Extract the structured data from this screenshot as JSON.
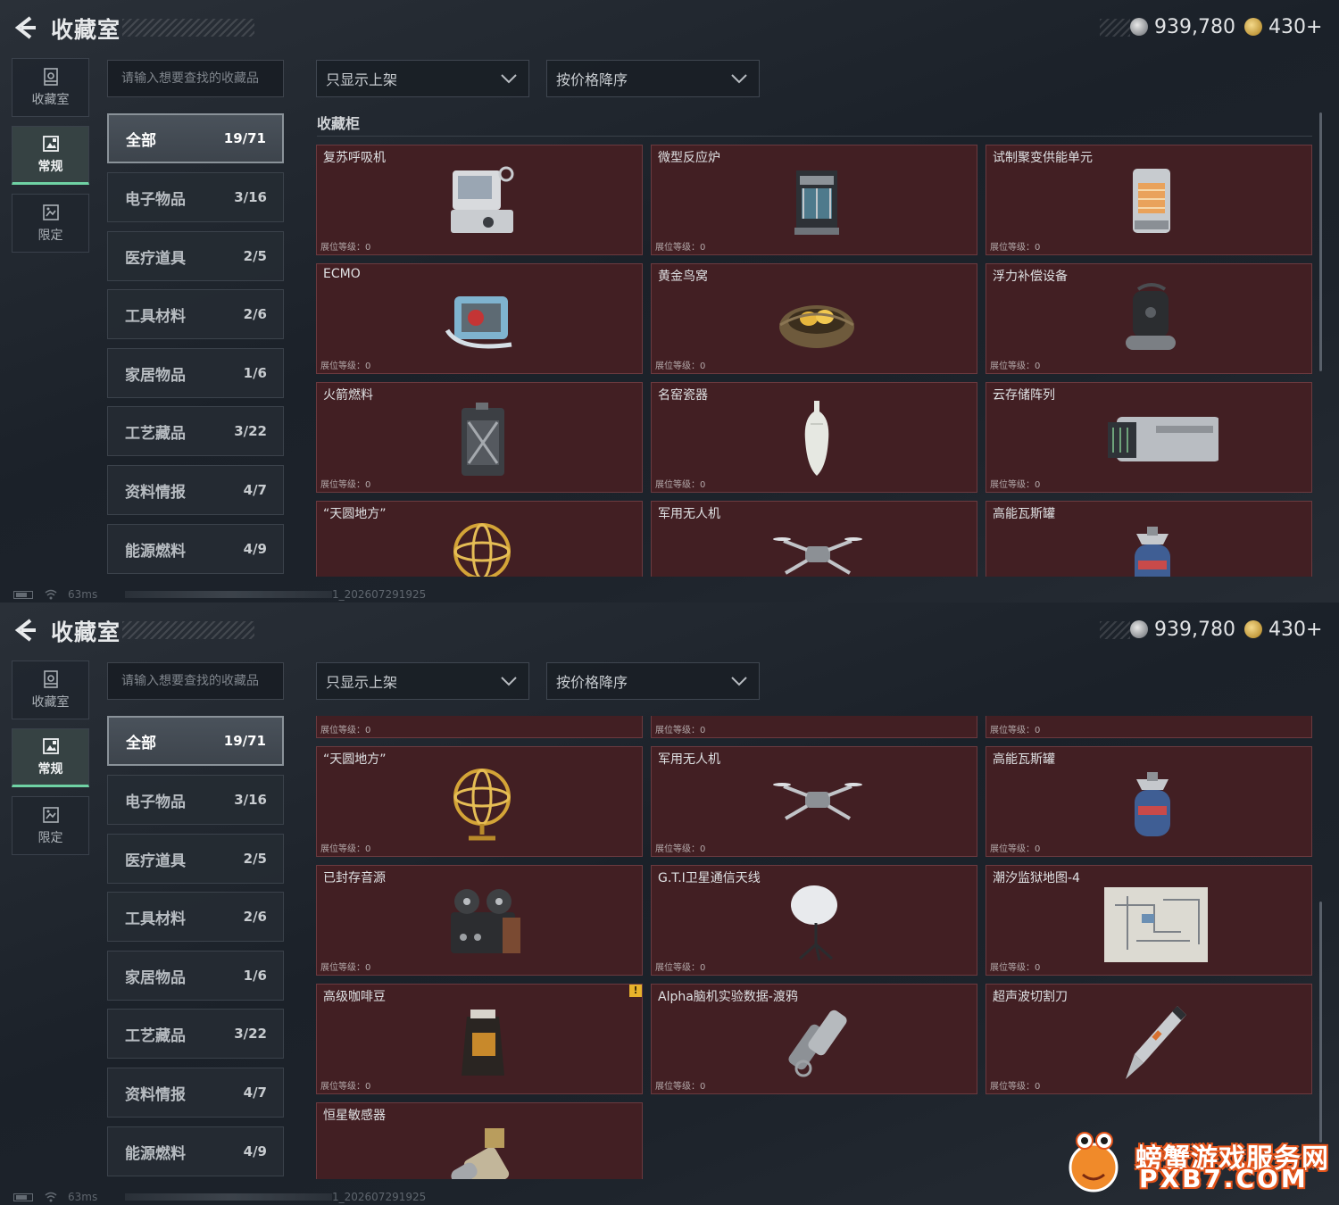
{
  "header": {
    "title": "收藏室",
    "currency_silver": "939,780",
    "currency_gold": "430+"
  },
  "nav": [
    {
      "label": "收藏室",
      "icon": "collection-room-icon"
    },
    {
      "label": "常规",
      "icon": "gallery-icon",
      "active": true
    },
    {
      "label": "限定",
      "icon": "limited-image-icon"
    }
  ],
  "search": {
    "placeholder": "请输入想要查找的收藏品"
  },
  "categories": [
    {
      "name": "全部",
      "count": "19/71"
    },
    {
      "name": "电子物品",
      "count": "3/16"
    },
    {
      "name": "医疗道具",
      "count": "2/5"
    },
    {
      "name": "工具材料",
      "count": "2/6"
    },
    {
      "name": "家居物品",
      "count": "1/6"
    },
    {
      "name": "工艺藏品",
      "count": "3/22"
    },
    {
      "name": "资料情报",
      "count": "4/7"
    },
    {
      "name": "能源燃料",
      "count": "4/9"
    }
  ],
  "filters": {
    "show_filter": "只显示上架",
    "sort": "按价格降序"
  },
  "section_title": "收藏柜",
  "level_label": "展位等级：0",
  "top_items": [
    {
      "name": "复苏呼吸机",
      "icon": "ventilator-icon"
    },
    {
      "name": "微型反应炉",
      "icon": "reactor-icon"
    },
    {
      "name": "试制聚变供能单元",
      "icon": "fusion-unit-icon"
    },
    {
      "name": "ECMO",
      "icon": "ecmo-icon"
    },
    {
      "name": "黄金鸟窝",
      "icon": "golden-nest-icon"
    },
    {
      "name": "浮力补偿设备",
      "icon": "buoyancy-device-icon"
    },
    {
      "name": "火箭燃料",
      "icon": "fuel-can-icon"
    },
    {
      "name": "名窑瓷器",
      "icon": "porcelain-vase-icon"
    },
    {
      "name": "云存储阵列",
      "icon": "storage-array-icon"
    },
    {
      "name": "“天圆地方”",
      "icon": "armillary-sphere-icon"
    },
    {
      "name": "军用无人机",
      "icon": "drone-icon"
    },
    {
      "name": "高能瓦斯罐",
      "icon": "gas-tank-icon"
    }
  ],
  "bottom_items": [
    {
      "name": "",
      "icon": ""
    },
    {
      "name": "",
      "icon": ""
    },
    {
      "name": "",
      "icon": ""
    },
    {
      "name": "“天圆地方”",
      "icon": "armillary-sphere-icon"
    },
    {
      "name": "军用无人机",
      "icon": "drone-icon"
    },
    {
      "name": "高能瓦斯罐",
      "icon": "gas-tank-icon"
    },
    {
      "name": "已封存音源",
      "icon": "tape-recorder-icon"
    },
    {
      "name": "G.T.I卫星通信天线",
      "icon": "satellite-dish-icon"
    },
    {
      "name": "潮汐监狱地图-4",
      "icon": "map-icon"
    },
    {
      "name": "高级咖啡豆",
      "icon": "coffee-bag-icon",
      "warn": "!"
    },
    {
      "name": "Alpha脑机实验数据-渡鸦",
      "icon": "data-drive-icon"
    },
    {
      "name": "超声波切割刀",
      "icon": "ultrasonic-cutter-icon"
    },
    {
      "name": "恒星敏感器",
      "icon": "star-sensor-icon"
    }
  ],
  "status": {
    "ping": "63ms",
    "build": "1_202607291925"
  },
  "watermark": {
    "line1": "螃蟹游戏服务网",
    "line2": "PXB7.COM"
  },
  "colors": {
    "card_bg": "#421f23",
    "card_border": "#6b3a3f",
    "accent_green": "#6fd2a4"
  }
}
